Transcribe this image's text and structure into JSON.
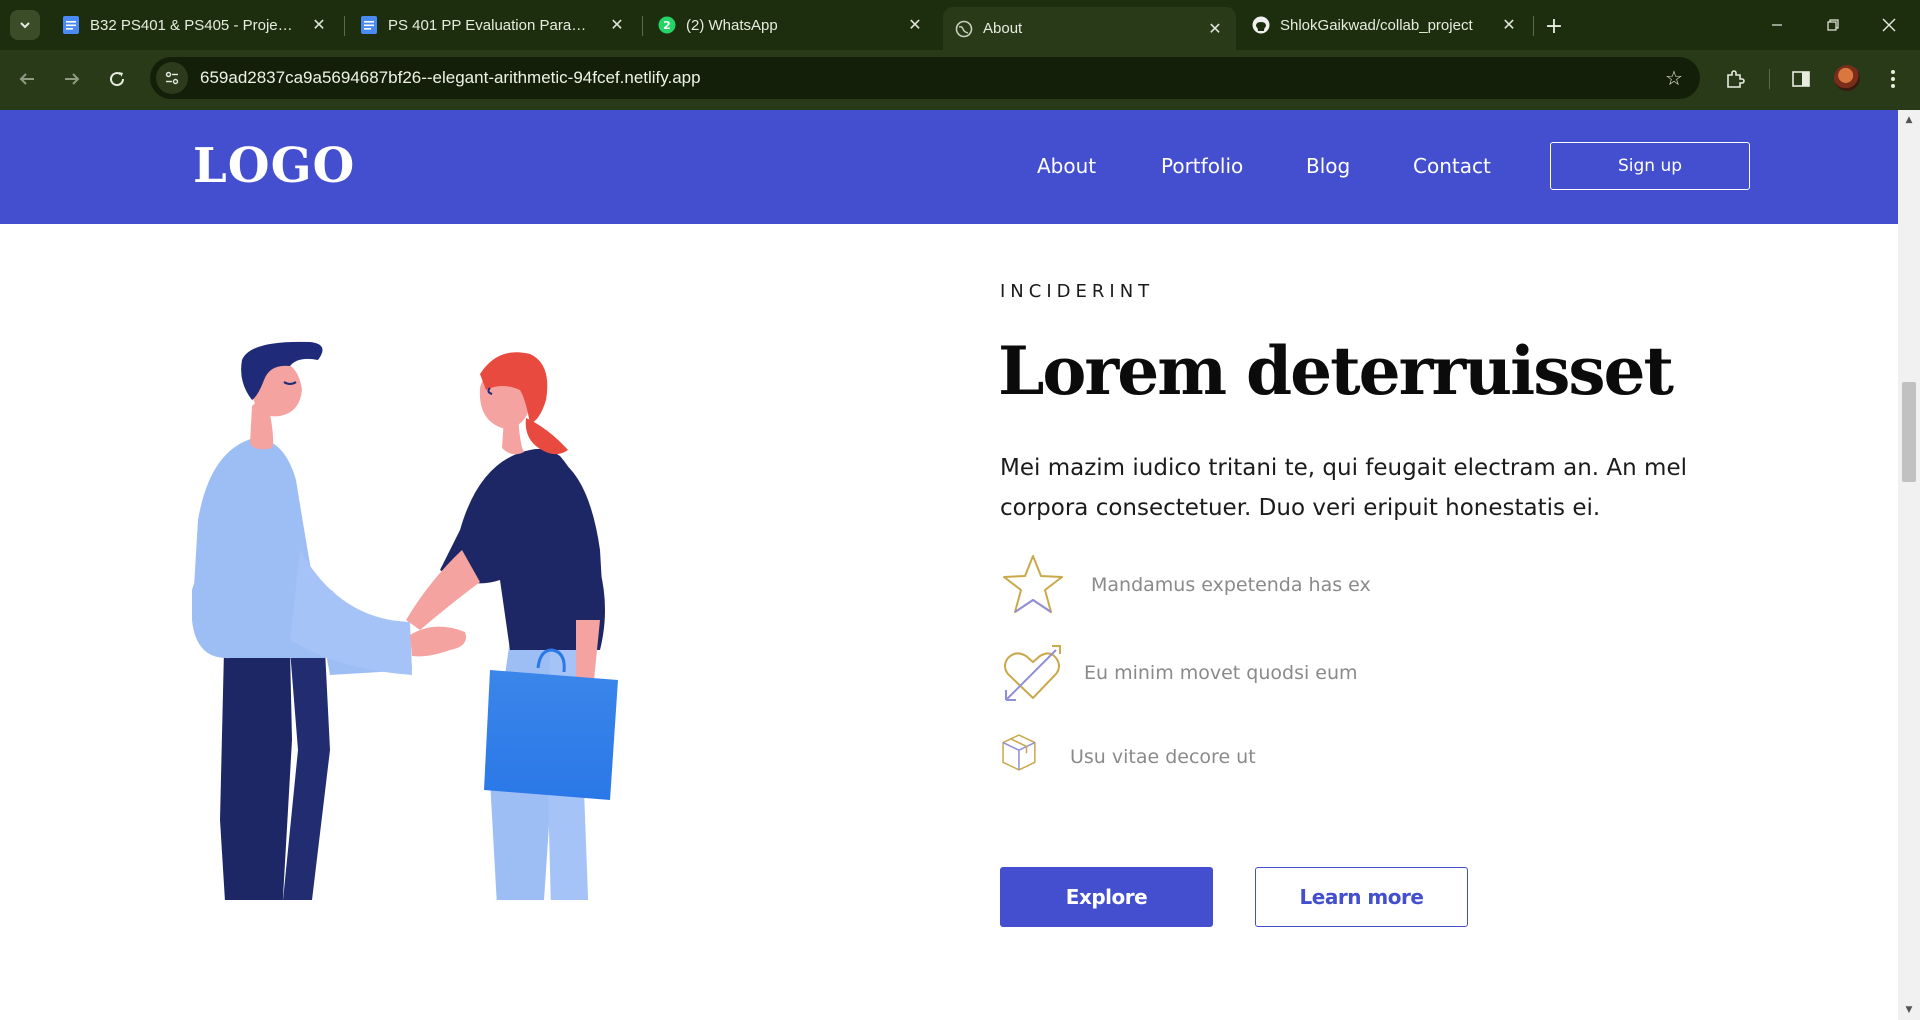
{
  "browser": {
    "tabs": [
      {
        "title": "B32 PS401 & PS405 - Project Pr",
        "icon": "google-docs-icon",
        "active": false
      },
      {
        "title": "PS 401 PP Evaluation Parameter",
        "icon": "google-docs-icon",
        "active": false
      },
      {
        "title": "(2) WhatsApp",
        "icon": "whatsapp-icon",
        "badge": "2",
        "active": false
      },
      {
        "title": "About",
        "icon": "globe-icon",
        "active": true
      },
      {
        "title": "ShlokGaikwad/collab_project",
        "icon": "github-icon",
        "active": false
      }
    ],
    "url": "659ad2837ca9a5694687bf26--elegant-arithmetic-94fcef.netlify.app"
  },
  "site": {
    "logo": "LOGO",
    "nav": [
      "About",
      "Portfolio",
      "Blog",
      "Contact"
    ],
    "signup": "Sign up"
  },
  "hero": {
    "eyebrow": "INCIDERINT",
    "title": "Lorem deterruisset",
    "lead": "Mei mazim iudico tritani te, qui feugait electram an. An mel corpora consectetuer. Duo veri eripuit honestatis ei.",
    "features": [
      {
        "icon": "star-icon",
        "text": "Mandamus expetenda has ex"
      },
      {
        "icon": "heart-arrow-icon",
        "text": "Eu minim movet quodsi eum"
      },
      {
        "icon": "box-icon",
        "text": "Usu vitae decore ut"
      }
    ],
    "explore": "Explore",
    "learn_more": "Learn more"
  },
  "colors": {
    "brand": "#434fcf",
    "chrome": "#283a18"
  }
}
